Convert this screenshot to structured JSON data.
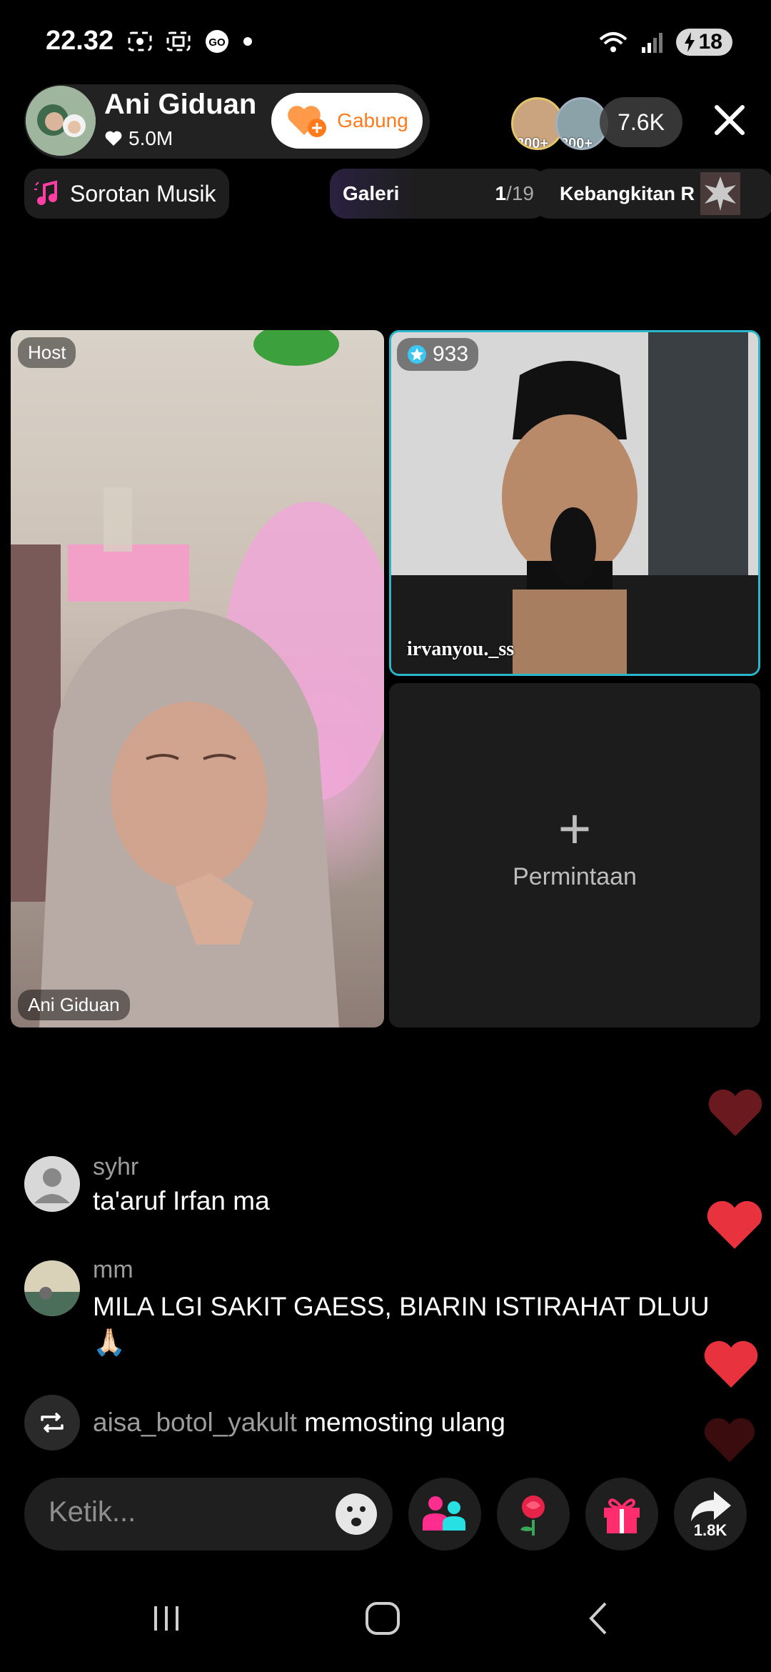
{
  "status_bar": {
    "time": "22.32",
    "battery": "18"
  },
  "header": {
    "host_name": "Ani Giduan",
    "likes": "5.0M",
    "join_label": "Gabung",
    "viewer_badges": [
      "200+",
      "200+"
    ],
    "viewer_count": "7.6K"
  },
  "chips": {
    "music": "Sorotan Musik",
    "gallery_label": "Galeri",
    "gallery_current": "1",
    "gallery_total": "/19",
    "rank": "Kebangkitan R"
  },
  "tiles": {
    "host_tag": "Host",
    "host_name": "Ani Giduan",
    "guest_score": "933",
    "guest_name": "irvanyou._ss",
    "request_label": "Permintaan"
  },
  "chat": [
    {
      "user": "syhr",
      "text": "ta'aruf Irfan ma"
    },
    {
      "user": "mm",
      "text": "MILA LGI SAKIT GAESS, BIARIN ISTIRAHAT DLUU",
      "emoji": "🙏🏻"
    },
    {
      "user": "aisa_botol_yakult",
      "text": "memosting ulang"
    }
  ],
  "bottom": {
    "input_placeholder": "Ketik...",
    "share_count": "1.8K"
  },
  "colors": {
    "accent_orange": "#ff7a1a",
    "guest_border": "#29b6c8",
    "heart": "#e8333f"
  }
}
